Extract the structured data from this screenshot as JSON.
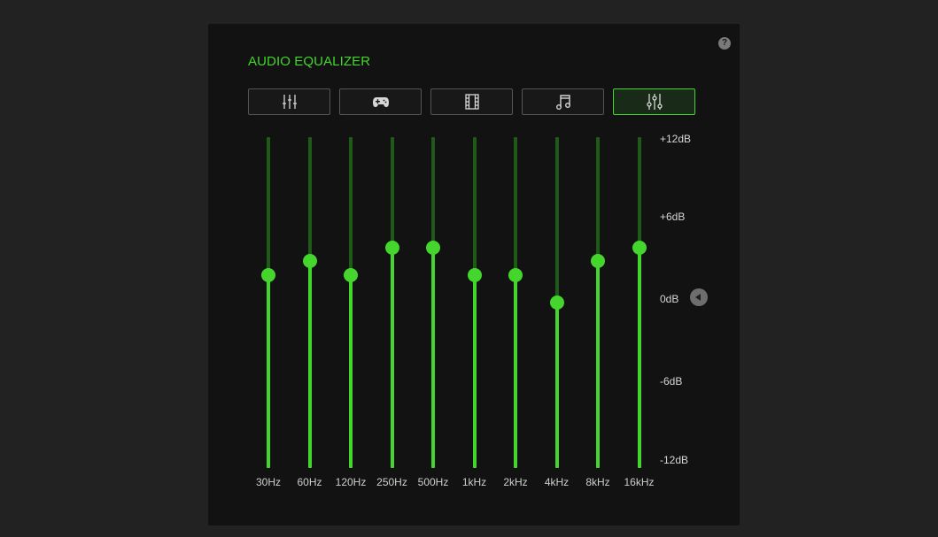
{
  "title": "AUDIO EQUALIZER",
  "help_label": "?",
  "presets": [
    {
      "icon": "equalizer-sliders-icon",
      "active": false
    },
    {
      "icon": "gamepad-icon",
      "active": false
    },
    {
      "icon": "film-icon",
      "active": false
    },
    {
      "icon": "music-note-icon",
      "active": false
    },
    {
      "icon": "custom-sliders-icon",
      "active": true
    }
  ],
  "db_scale": {
    "top": "+12dB",
    "upper": "+6dB",
    "mid": "0dB",
    "lower": "-6dB",
    "bottom": "-12dB"
  },
  "db_range": [
    -12,
    12
  ],
  "bands": [
    {
      "label": "30Hz",
      "db": 2
    },
    {
      "label": "60Hz",
      "db": 3
    },
    {
      "label": "120Hz",
      "db": 2
    },
    {
      "label": "250Hz",
      "db": 4
    },
    {
      "label": "500Hz",
      "db": 4
    },
    {
      "label": "1kHz",
      "db": 2
    },
    {
      "label": "2kHz",
      "db": 2
    },
    {
      "label": "4kHz",
      "db": 0
    },
    {
      "label": "8kHz",
      "db": 3
    },
    {
      "label": "16kHz",
      "db": 4
    }
  ],
  "colors": {
    "accent": "#44d62c",
    "track_bg": "#1f5a18",
    "panel": "#121212",
    "page": "#222222"
  }
}
